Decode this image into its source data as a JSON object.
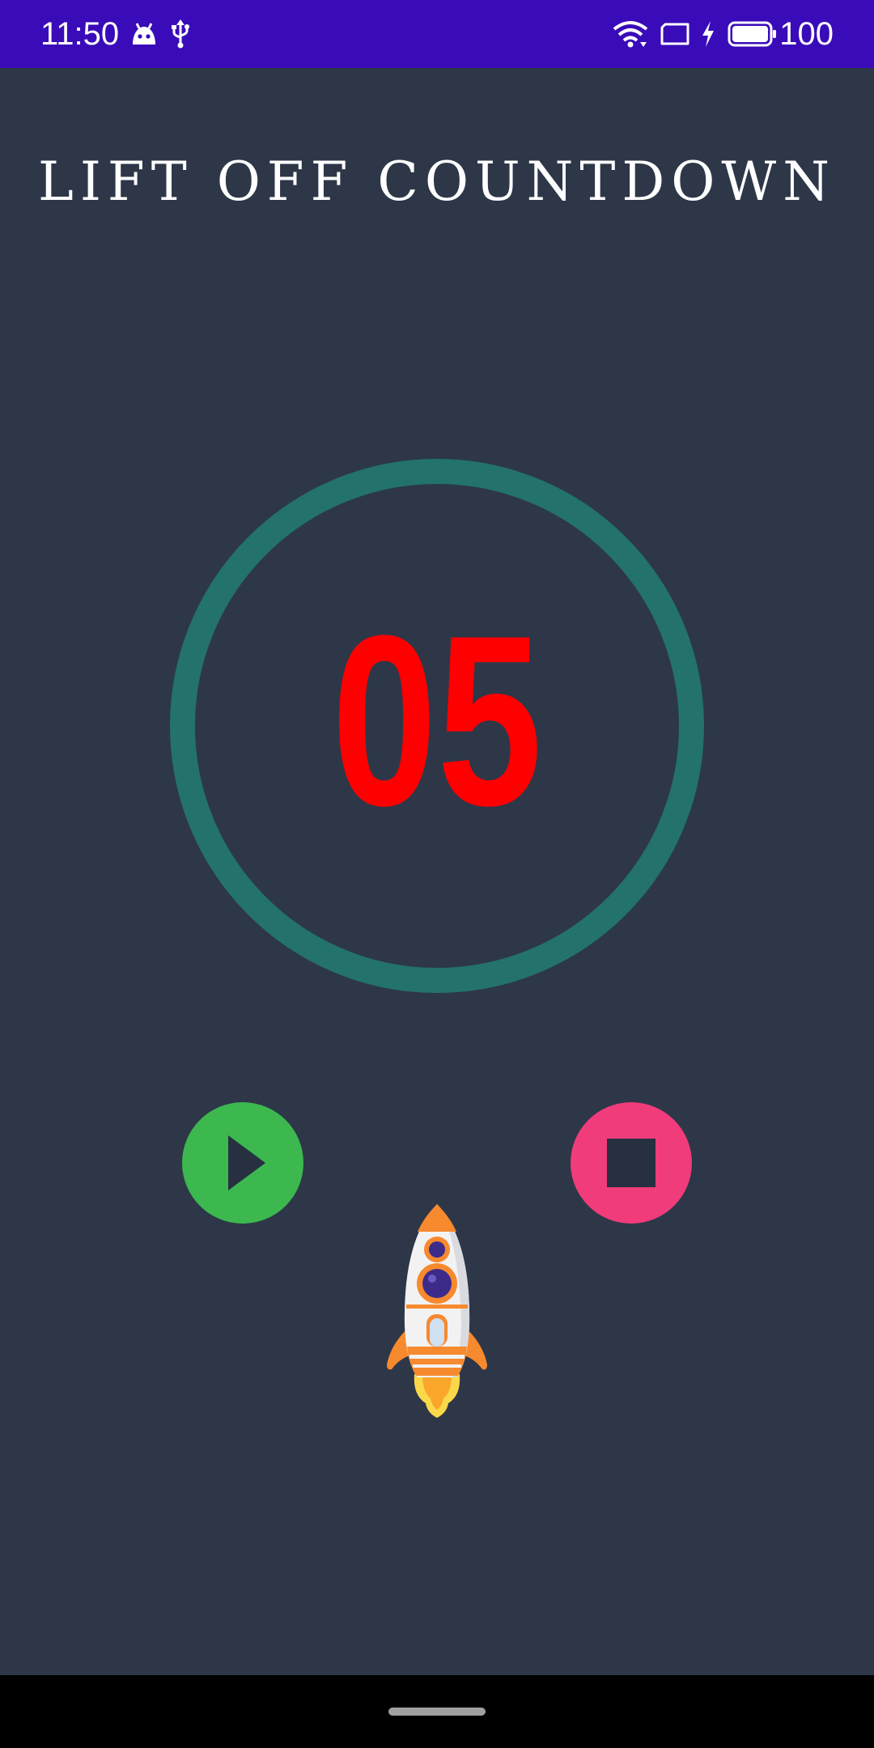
{
  "status_bar": {
    "time": "11:50",
    "battery_level": "100",
    "icons": [
      "android-icon",
      "usb-icon",
      "wifi-icon",
      "screen-rotate-icon",
      "charging-icon",
      "battery-icon"
    ],
    "background_color": "#3a0bb8"
  },
  "screen": {
    "title": "LIFT OFF COUNTDOWN",
    "countdown_value": "05",
    "countdown_color": "#ff0000",
    "ring_color": "#23726c",
    "background_color": "#2d3748"
  },
  "controls": {
    "play_icon": "play-icon",
    "play_color": "#3cb84f",
    "stop_icon": "stop-icon",
    "stop_color": "#f03c7a"
  },
  "illustration": {
    "icon": "rocket-icon"
  }
}
